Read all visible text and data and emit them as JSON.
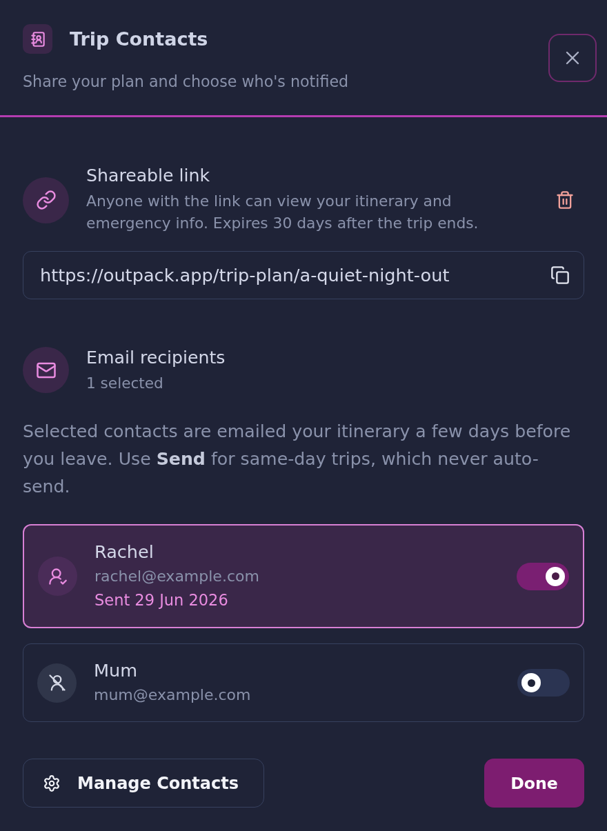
{
  "dialog": {
    "title": "Trip Contacts",
    "subtitle": "Share your plan and choose who's notified"
  },
  "share_link": {
    "title": "Shareable link",
    "description": "Anyone with the link can view your itinerary and emergency info. Expires 30 days after the trip ends.",
    "url": "https://outpack.app/trip-plan/a-quiet-night-out"
  },
  "email_recipients": {
    "title": "Email recipients",
    "count": "1 selected",
    "note": "Selected contacts are emailed your itinerary a few days before you leave. Use **Send** for same-day trips, which never auto-send."
  },
  "contacts": [
    {
      "name": "Rachel",
      "email": "rachel@example.com",
      "status": "Sent 29 Jun 2026",
      "on": true
    },
    {
      "name": "Mum",
      "email": "mum@example.com",
      "on": false
    }
  ],
  "footer": {
    "manage_button": "Manage Contacts",
    "done_button": "Done"
  }
}
